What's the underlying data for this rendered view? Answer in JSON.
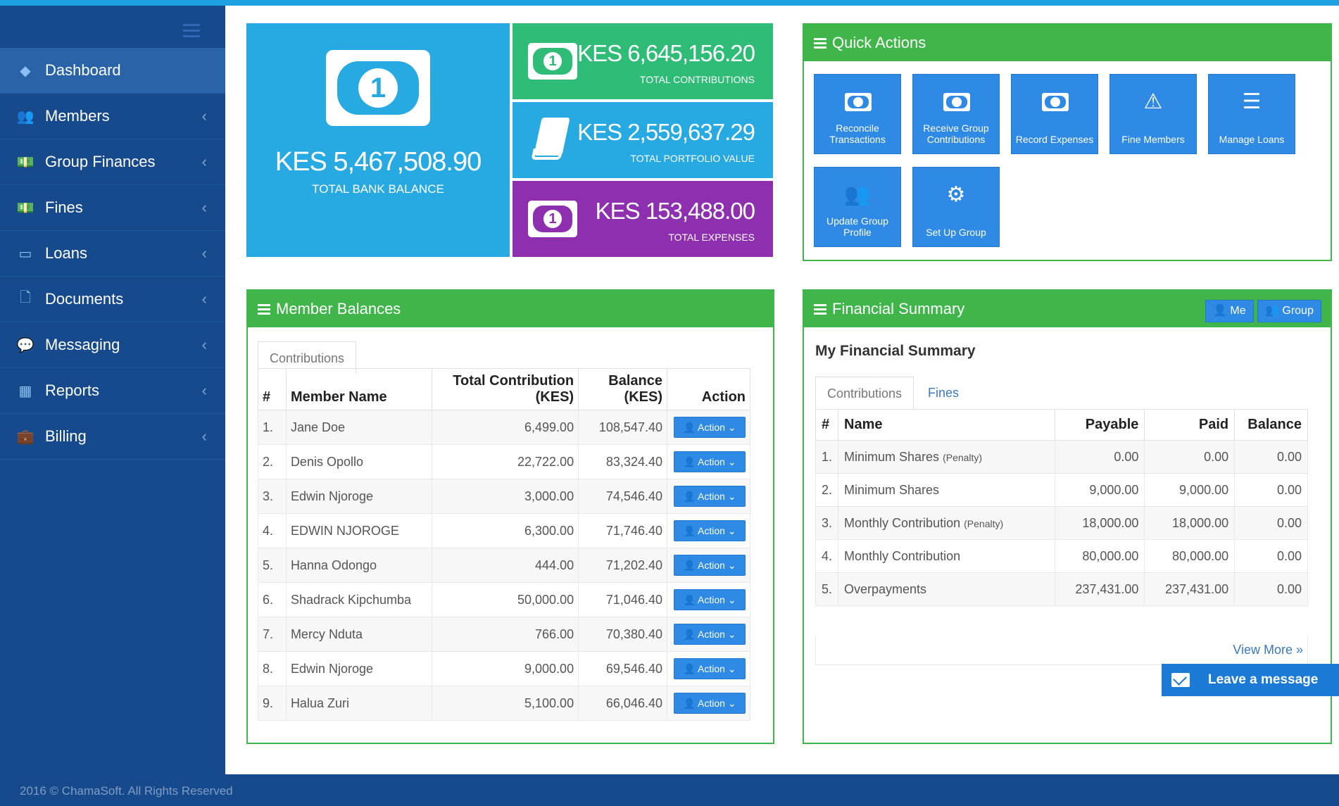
{
  "sidebar": {
    "items": [
      {
        "label": "Dashboard",
        "icon": "dashboard-icon",
        "glyph": "◆",
        "active": true
      },
      {
        "label": "Members",
        "icon": "users-icon",
        "glyph": "👥"
      },
      {
        "label": "Group Finances",
        "icon": "money-icon",
        "glyph": "💵"
      },
      {
        "label": "Fines",
        "icon": "money-icon",
        "glyph": "💵"
      },
      {
        "label": "Loans",
        "icon": "credit-card-icon",
        "glyph": "▭"
      },
      {
        "label": "Documents",
        "icon": "file-icon",
        "glyph": "🗋"
      },
      {
        "label": "Messaging",
        "icon": "comments-icon",
        "glyph": "💬"
      },
      {
        "label": "Reports",
        "icon": "table-icon",
        "glyph": "▦"
      },
      {
        "label": "Billing",
        "icon": "briefcase-icon",
        "glyph": "💼"
      }
    ]
  },
  "stats": {
    "bank": {
      "value": "KES 5,467,508.90",
      "label": "TOTAL BANK BALANCE",
      "color": "#27a9e1"
    },
    "contributions": {
      "value": "KES 6,645,156.20",
      "label": "TOTAL CONTRIBUTIONS",
      "color": "#2ebc77"
    },
    "portfolio": {
      "value": "KES 2,559,637.29",
      "label": "TOTAL PORTFOLIO VALUE",
      "color": "#27a9e1"
    },
    "expenses": {
      "value": "KES 153,488.00",
      "label": "TOTAL EXPENSES",
      "color": "#8e2fb0"
    }
  },
  "quick_actions": {
    "title": "Quick Actions",
    "buttons": [
      {
        "label": "Reconcile Transactions",
        "icon": "money-icon"
      },
      {
        "label": "Receive Group Contributions",
        "icon": "money-icon"
      },
      {
        "label": "Record Expenses",
        "icon": "money-icon"
      },
      {
        "label": "Fine Members",
        "icon": "warning-icon"
      },
      {
        "label": "Manage Loans",
        "icon": "list-icon"
      },
      {
        "label": "Update Group Profile",
        "icon": "users-icon"
      },
      {
        "label": "Set Up Group",
        "icon": "gears-icon"
      }
    ]
  },
  "member_balances": {
    "title": "Member Balances",
    "tab": "Contributions",
    "columns": {
      "num": "#",
      "name": "Member Name",
      "total_line1": "Total Contribution",
      "total_line2": "(KES)",
      "balance_line1": "Balance",
      "balance_line2": "(KES)",
      "action": "Action"
    },
    "action_label": "Action",
    "rows": [
      {
        "n": "1.",
        "name": "Jane Doe",
        "total": "6,499.00",
        "balance": "108,547.40"
      },
      {
        "n": "2.",
        "name": "Denis Opollo",
        "total": "22,722.00",
        "balance": "83,324.40"
      },
      {
        "n": "3.",
        "name": "Edwin Njoroge",
        "total": "3,000.00",
        "balance": "74,546.40"
      },
      {
        "n": "4.",
        "name": "EDWIN NJOROGE",
        "total": "6,300.00",
        "balance": "71,746.40"
      },
      {
        "n": "5.",
        "name": "Hanna Odongo",
        "total": "444.00",
        "balance": "71,202.40"
      },
      {
        "n": "6.",
        "name": "Shadrack Kipchumba",
        "total": "50,000.00",
        "balance": "71,046.40"
      },
      {
        "n": "7.",
        "name": "Mercy Nduta",
        "total": "766.00",
        "balance": "70,380.40"
      },
      {
        "n": "8.",
        "name": "Edwin Njoroge",
        "total": "9,000.00",
        "balance": "69,546.40"
      },
      {
        "n": "9.",
        "name": "Halua Zuri",
        "total": "5,100.00",
        "balance": "66,046.40"
      }
    ]
  },
  "financial_summary": {
    "title": "Financial Summary",
    "me_label": "Me",
    "group_label": "Group",
    "subtitle": "My Financial Summary",
    "tabs": [
      "Contributions",
      "Fines"
    ],
    "columns": {
      "num": "#",
      "name": "Name",
      "payable": "Payable",
      "paid": "Paid",
      "balance": "Balance"
    },
    "rows": [
      {
        "n": "1.",
        "name": "Minimum Shares",
        "suffix": "(Penalty)",
        "payable": "0.00",
        "paid": "0.00",
        "balance": "0.00"
      },
      {
        "n": "2.",
        "name": "Minimum Shares",
        "suffix": "",
        "payable": "9,000.00",
        "paid": "9,000.00",
        "balance": "0.00"
      },
      {
        "n": "3.",
        "name": "Monthly Contribution",
        "suffix": "(Penalty)",
        "payable": "18,000.00",
        "paid": "18,000.00",
        "balance": "0.00"
      },
      {
        "n": "4.",
        "name": "Monthly Contribution",
        "suffix": "",
        "payable": "80,000.00",
        "paid": "80,000.00",
        "balance": "0.00"
      },
      {
        "n": "5.",
        "name": "Overpayments",
        "suffix": "",
        "payable": "237,431.00",
        "paid": "237,431.00",
        "balance": "0.00"
      }
    ],
    "view_more": "View More »"
  },
  "chat": {
    "label": "Leave a message"
  },
  "footer": {
    "text": "2016 © ChamaSoft. All Rights Reserved"
  }
}
